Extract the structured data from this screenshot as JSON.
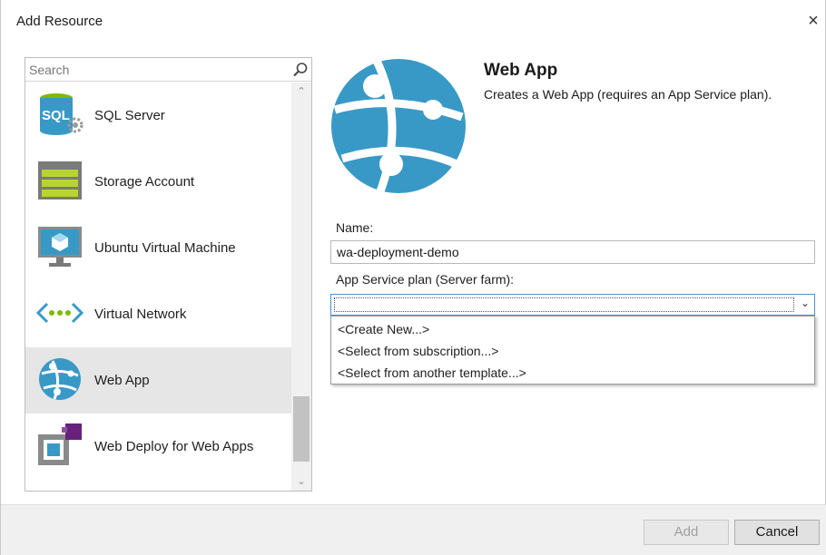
{
  "dialog": {
    "title": "Add Resource",
    "close_glyph": "×"
  },
  "search": {
    "placeholder": "Search",
    "icon": "search-icon"
  },
  "resources": [
    {
      "label": "SQL Server",
      "icon": "sql-server-icon"
    },
    {
      "label": "Storage Account",
      "icon": "storage-account-icon"
    },
    {
      "label": "Ubuntu Virtual Machine",
      "icon": "virtual-machine-icon"
    },
    {
      "label": "Virtual Network",
      "icon": "virtual-network-icon"
    },
    {
      "label": "Web App",
      "icon": "web-app-icon",
      "selected": true
    },
    {
      "label": "Web Deploy for Web Apps",
      "icon": "web-deploy-icon"
    }
  ],
  "detail": {
    "title": "Web App",
    "description": "Creates a Web App (requires an App Service plan).",
    "icon": "web-app-globe-icon"
  },
  "form": {
    "name_label": "Name:",
    "name_value": "wa-deployment-demo",
    "plan_label": "App Service plan (Server farm):",
    "plan_value": "",
    "plan_options": [
      "<Create New...>",
      "<Select from subscription...>",
      "<Select from another template...>"
    ]
  },
  "footer": {
    "add_label": "Add",
    "cancel_label": "Cancel"
  },
  "colors": {
    "azure_blue": "#3999c6",
    "selection_bg": "#e6e6e6",
    "footer_bg": "#f0f0f0",
    "focus_border": "#4a90d9"
  }
}
